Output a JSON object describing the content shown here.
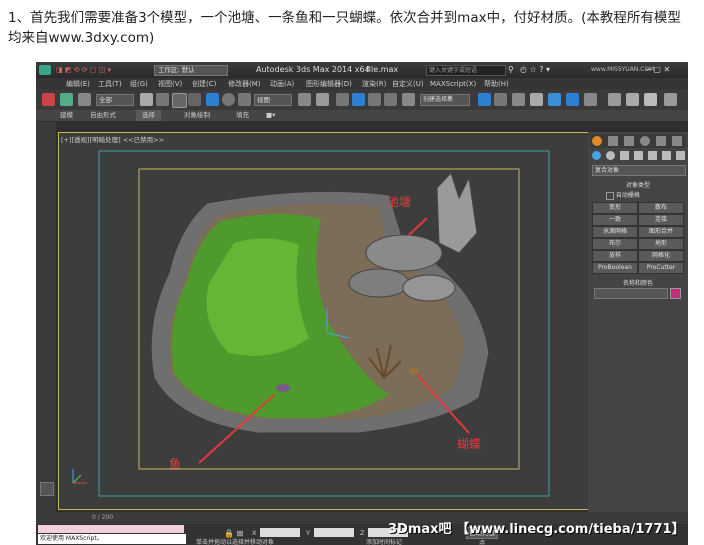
{
  "caption": {
    "line1": "1、首先我们需要准备3个模型，一个池塘、一条鱼和一只蝴蝶。依次合并到max中，付好材质。(本教程所有模型",
    "line2": "均来自www.3dxy.com)"
  },
  "window": {
    "title": "Autodesk 3ds Max  2014 x64",
    "file": "file.max",
    "workspace_label": "工作区: 默认",
    "search_placeholder": "键入关键字或短语",
    "site_watermark": "www.MISSYUAN.COM"
  },
  "menu": [
    "编辑(E)",
    "工具(T)",
    "组(G)",
    "视图(V)",
    "创建(C)",
    "修改器(M)",
    "动画(A)",
    "图形编辑器(D)",
    "渲染(R)",
    "自定义(U)",
    "MAXScript(X)",
    "帮助(H)"
  ],
  "toolbar": {
    "selection_filter": "全部",
    "view_dropdown": "视图",
    "selection_set": "创建选择集"
  },
  "ribbon": [
    "建模",
    "自由形式",
    "选择",
    "对象绘制",
    "填充"
  ],
  "viewport": {
    "label": "[+][透视][明暗处理] <<已禁用>>",
    "annotations": {
      "pond": "池塘",
      "fish": "鱼",
      "butterfly": "蝴蝶"
    }
  },
  "command_panel": {
    "category": "标准基本体",
    "dropdown": "复合对象",
    "rollout_object_type": "对象类型",
    "autogrid": "自动栅格",
    "buttons": [
      "变形",
      "散布",
      "一致",
      "连接",
      "水滴网格",
      "图形合并",
      "布尔",
      "地形",
      "放样",
      "网格化",
      "ProBoolean",
      "ProCutter"
    ],
    "rollout_name_color": "名称和颜色",
    "name_color_swatch": "#c0307a"
  },
  "timeline": {
    "frame": "0 / 200"
  },
  "status": {
    "maxscript": "欢迎使用 MAXScript。",
    "x_label": "X",
    "y_label": "Y",
    "z_label": "Z",
    "addtime": "添加时间标记",
    "autokey": "自动关键点",
    "hint": "单击并拖动以选择并移动对象"
  },
  "bottom_watermark": "3Dmax吧 【www.linecg.com/tieba/1771】",
  "colors": {
    "accent": "#4aa3df",
    "annotation": "#e23a3a",
    "safe_frame": "#c8b65a",
    "teal_frame": "#3aa0a8"
  }
}
